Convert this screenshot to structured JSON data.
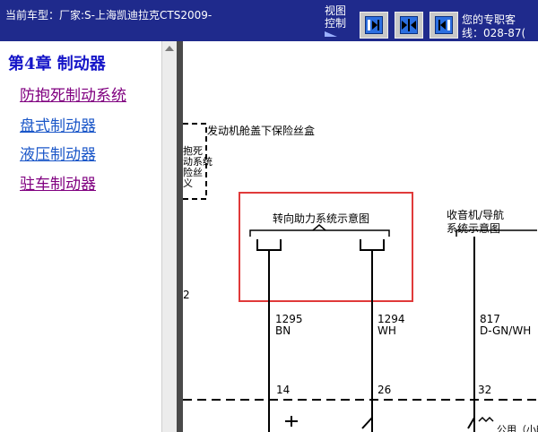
{
  "header": {
    "car_info": "当前车型：厂家:S-上海凯迪拉克CTS2009-",
    "view_control": [
      "视图",
      "控制"
    ],
    "hotline": [
      "您的专职客",
      "线：028-87("
    ],
    "buttons": [
      "next-page",
      "split-view",
      "previous-page"
    ]
  },
  "sidebar": {
    "chapter_title": "第4章 制动器",
    "links": [
      "防抱死制动系统",
      "盘式制动器",
      "液压制动器",
      "驻车制动器"
    ]
  },
  "diagram": {
    "fuse_box_label": "发动机舱盖下保险丝盒",
    "partial_box_text": [
      "抱死",
      "动系统",
      "险丝",
      "义"
    ],
    "partial_number": "2",
    "power_steering_label": "转向助力系统示意图",
    "radio_nav_label": [
      "收音机/导航",
      "系统示意图"
    ],
    "wires": [
      {
        "circuit": "1295",
        "color": "BN",
        "pin": "14"
      },
      {
        "circuit": "1294",
        "color": "WH",
        "pin": "26"
      },
      {
        "circuit": "817",
        "color": "D-GN/WH",
        "pin": "32"
      }
    ],
    "bottom_partial": "公用（小时"
  },
  "colors": {
    "header_bg": "#1f2a8c",
    "chapter_title": "#1515c8",
    "visited_link": "#800080",
    "link": "#1a56c8",
    "highlight_box": "#e03a3a"
  }
}
